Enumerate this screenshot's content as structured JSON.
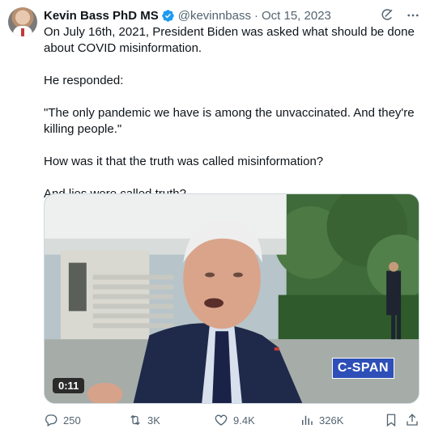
{
  "tweet": {
    "author": {
      "name": "Kevin Bass PhD MS",
      "handle": "@kevinnbass",
      "separator": "·",
      "date": "Oct 15, 2023",
      "verified": true
    },
    "paragraphs": [
      "On July 16th, 2021, President Biden was asked what should be done about COVID misinformation.",
      "He responded:",
      "\"The only pandemic we have is among the unvaccinated. And they're killing people.\"",
      "How was it that the truth was called misinformation?",
      "And lies were called truth?"
    ],
    "media": {
      "duration": "0:11",
      "watermark": "C-SPAN"
    },
    "actions": {
      "replies": "250",
      "reposts": "3K",
      "likes": "9.4K",
      "views": "326K"
    }
  },
  "icons": {
    "verified": "verified-badge-icon",
    "grok": "grok-icon",
    "more": "more-icon",
    "reply": "reply-icon",
    "repost": "repost-icon",
    "like": "like-icon",
    "views": "views-icon",
    "bookmark": "bookmark-icon",
    "share": "share-icon"
  },
  "colors": {
    "text": "#0f1419",
    "secondary": "#536471",
    "verified": "#1d9bf0",
    "cspan": "#2e4fb8"
  }
}
